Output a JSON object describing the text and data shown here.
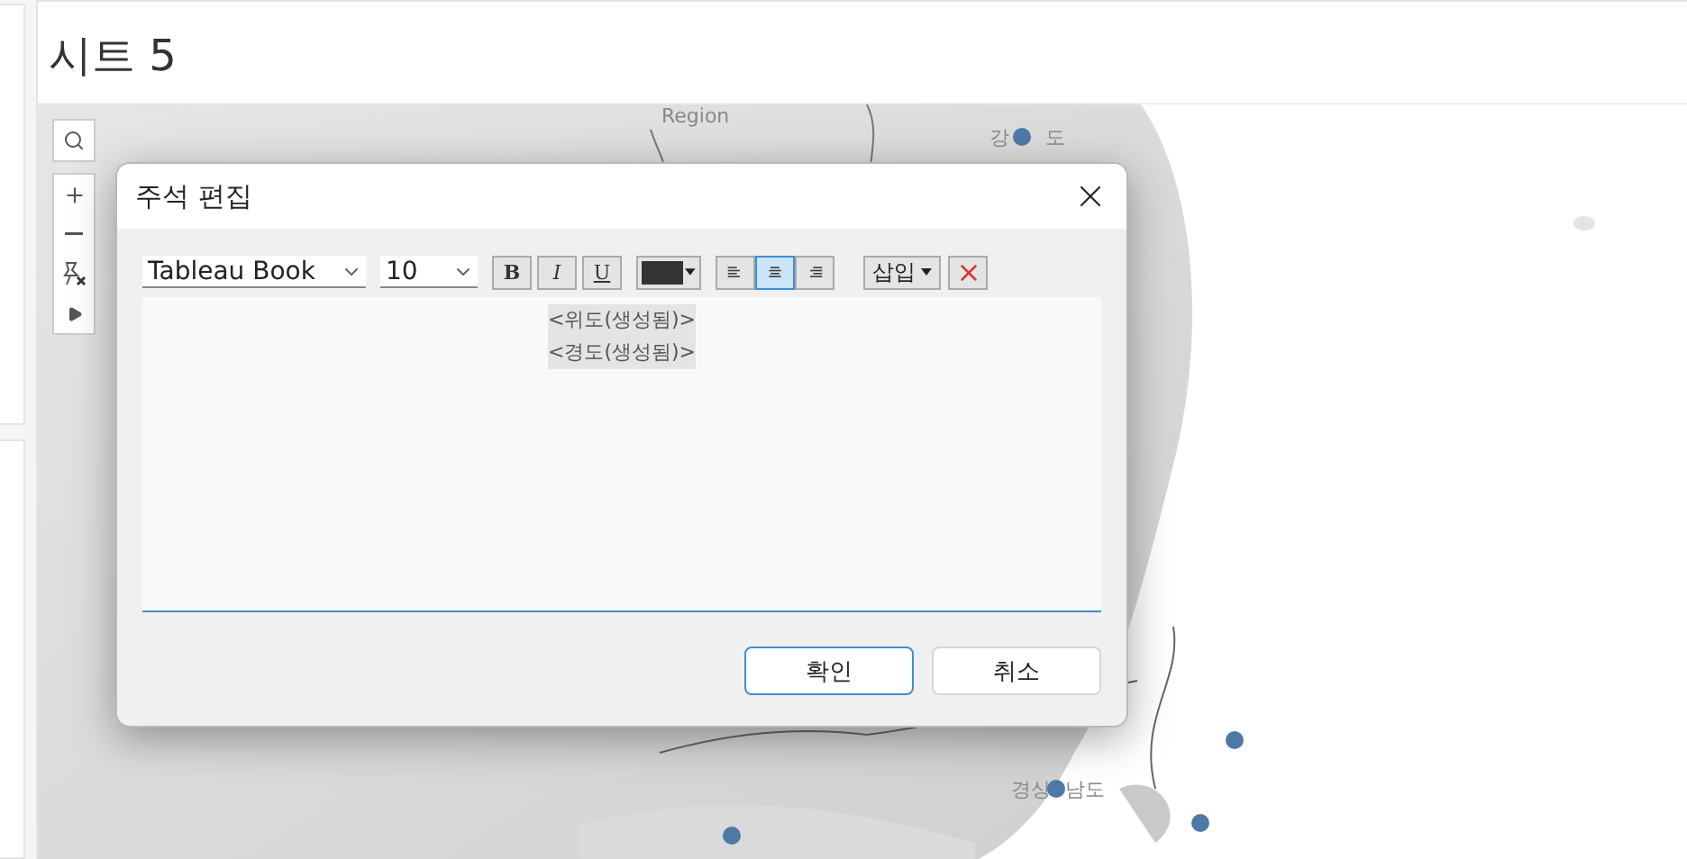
{
  "sheet_title": "시트 5",
  "map": {
    "labels": [
      {
        "text": "Region"
      },
      {
        "text": "강"
      },
      {
        "text": "도"
      },
      {
        "text": "경상"
      },
      {
        "text": "남도"
      }
    ]
  },
  "dialog": {
    "title": "주석 편집",
    "font": "Tableau Book",
    "size": "10",
    "format": [
      {
        "kind": "bold",
        "label": "B",
        "on": false
      },
      {
        "kind": "italic",
        "label": "I",
        "on": false
      },
      {
        "kind": "underline",
        "label": "U",
        "on": false
      }
    ],
    "align": [
      {
        "kind": "left",
        "selected": false
      },
      {
        "kind": "center",
        "selected": true
      },
      {
        "kind": "right",
        "selected": false
      }
    ],
    "insert": "삽입",
    "lines": [
      "<위도(생성됨)>",
      "<경도(생성됨)>"
    ],
    "buttons": [
      {
        "label": "확인",
        "default": true
      },
      {
        "label": "취소",
        "default": false
      }
    ]
  }
}
